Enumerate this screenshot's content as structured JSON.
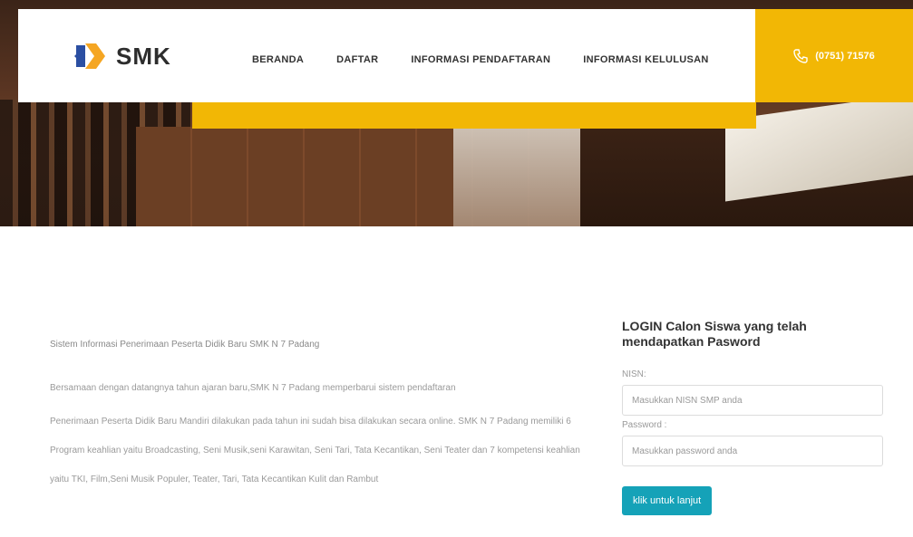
{
  "brand": {
    "name": "SMK",
    "colors": {
      "accent": "#f2b705",
      "button": "#15a2b8",
      "logo_blue": "#2b4fa2",
      "logo_orange": "#f5a623"
    }
  },
  "nav": {
    "items": [
      "BERANDA",
      "DAFTAR",
      "INFORMASI PENDAFTARAN",
      "INFORMASI KELULUSAN"
    ],
    "phone": "(0751) 71576",
    "phone_icon": "phone-icon"
  },
  "intro": {
    "title": "Sistem Informasi Penerimaan Peserta Didik Baru SMK N 7 Padang",
    "paragraph1": "Bersamaan dengan datangnya tahun ajaran baru,SMK N 7 Padang memperbarui sistem pendaftaran",
    "paragraph2": "Penerimaan Peserta Didik Baru Mandiri dilakukan pada tahun ini sudah bisa dilakukan secara online. SMK N 7 Padang memiliki 6 Program keahlian yaitu Broadcasting, Seni Musik,seni Karawitan, Seni Tari, Tata Kecantikan, Seni Teater dan 7 kompetensi keahlian yaitu TKI, Film,Seni Musik Populer, Teater, Tari, Tata Kecantikan Kulit dan Rambut"
  },
  "login": {
    "heading": "LOGIN Calon Siswa yang telah mendapatkan Pasword",
    "nisn_label": "NISN:",
    "nisn_placeholder": "Masukkan NISN SMP anda",
    "password_label": "Password :",
    "password_placeholder": "Masukkan password anda",
    "submit_label": "klik untuk lanjut"
  }
}
